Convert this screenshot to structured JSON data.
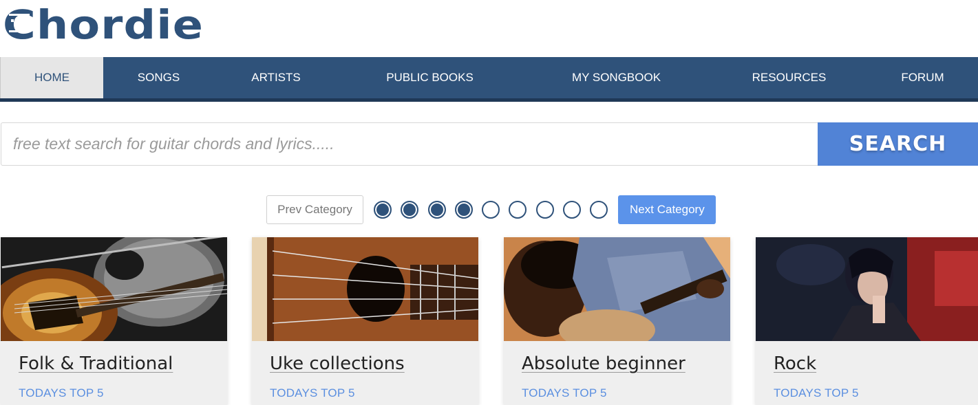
{
  "logo": {
    "text": "Chordie"
  },
  "nav": {
    "items": [
      {
        "label": "HOME",
        "active": true
      },
      {
        "label": "SONGS",
        "active": false
      },
      {
        "label": "ARTISTS",
        "active": false
      },
      {
        "label": "PUBLIC BOOKS",
        "active": false
      },
      {
        "label": "MY SONGBOOK",
        "active": false
      },
      {
        "label": "RESOURCES",
        "active": false
      },
      {
        "label": "FORUM",
        "active": false
      }
    ]
  },
  "search": {
    "placeholder": "free text search for guitar chords and lyrics.....",
    "value": "",
    "button_label": "SEARCH"
  },
  "pager": {
    "prev_label": "Prev Category",
    "next_label": "Next Category",
    "dots_filled": [
      true,
      true,
      true,
      true,
      false,
      false,
      false,
      false,
      false
    ]
  },
  "cards": [
    {
      "title": "Folk & Traditional",
      "subtitle": "TODAYS TOP 5",
      "image": "mandolin-guitar-photo"
    },
    {
      "title": "Uke collections",
      "subtitle": "TODAYS TOP 5",
      "image": "ukulele-photo"
    },
    {
      "title": "Absolute beginner",
      "subtitle": "TODAYS TOP 5",
      "image": "boy-playing-guitar-photo"
    },
    {
      "title": "Rock",
      "subtitle": "TODAYS TOP 5",
      "image": "rock-singer-photo"
    }
  ],
  "colors": {
    "brand": "#2f527a",
    "accent": "#5183d6",
    "link": "#5b8fe0"
  }
}
